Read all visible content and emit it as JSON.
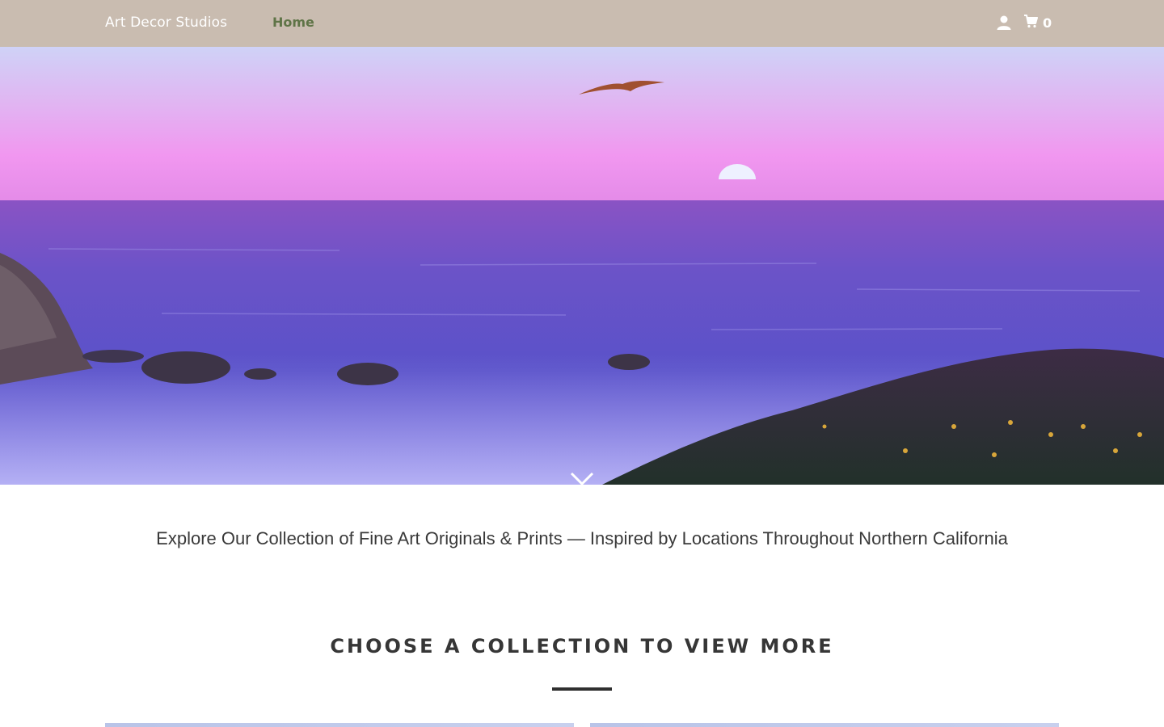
{
  "header": {
    "brand": "Art Decor Studios",
    "nav": [
      {
        "label": "Home",
        "active": true
      }
    ],
    "account_icon": "user-icon",
    "cart_icon": "shopping-cart-icon",
    "cart_count": "0"
  },
  "hero": {
    "image": "sunset-ocean-coast-photo",
    "scroll_icon": "chevron-down-icon"
  },
  "intro": {
    "text": "Explore Our Collection of Fine Art Originals & Prints — Inspired by Locations Throughout Northern California"
  },
  "collections": {
    "heading": "CHOOSE A COLLECTION TO VIEW MORE"
  },
  "colors": {
    "header_bg": "#c9bcb0",
    "nav_active": "#5f7447",
    "text": "#363636"
  }
}
